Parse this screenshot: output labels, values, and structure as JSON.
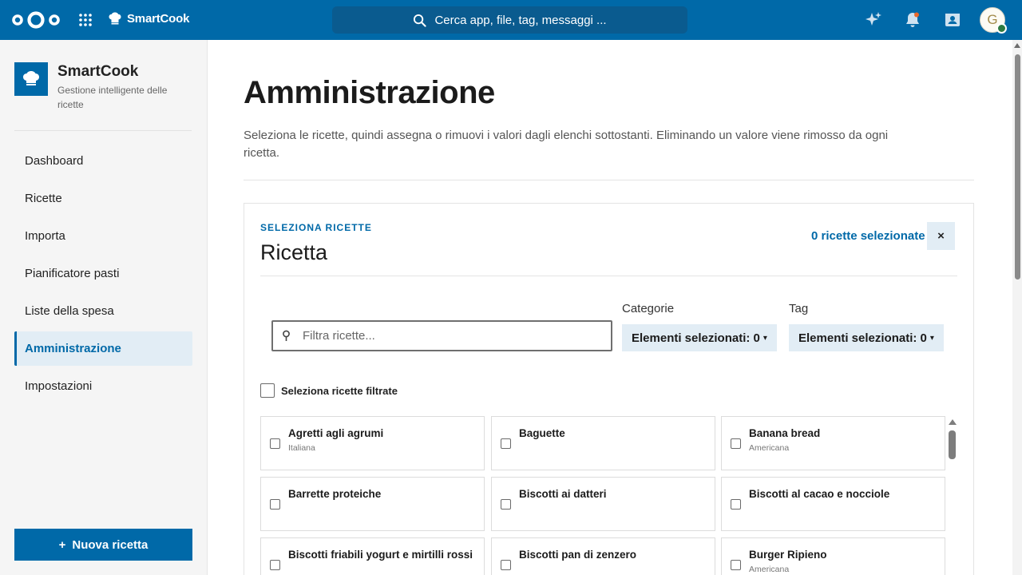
{
  "topbar": {
    "app_name": "SmartCook",
    "search_placeholder": "Cerca app, file, tag, messaggi ...",
    "avatar_initial": "G"
  },
  "sidebar": {
    "brand_title": "SmartCook",
    "brand_subtitle": "Gestione intelligente delle ricette",
    "items": [
      {
        "label": "Dashboard"
      },
      {
        "label": "Ricette"
      },
      {
        "label": "Importa"
      },
      {
        "label": "Pianificatore pasti"
      },
      {
        "label": "Liste della spesa"
      },
      {
        "label": "Amministrazione",
        "active": true
      },
      {
        "label": "Impostazioni"
      }
    ],
    "new_recipe_plus": "+",
    "new_recipe_label": "Nuova ricetta"
  },
  "main": {
    "title": "Amministrazione",
    "description": "Seleziona le ricette, quindi assegna o rimuovi i valori dagli elenchi sottostanti. Eliminando un valore viene rimosso da ogni ricetta.",
    "panel": {
      "overline": "SELEZIONA RICETTE",
      "title": "Ricetta",
      "selected_count": "0 ricette selezionate",
      "clear_label": "×",
      "filter_placeholder": "Filtra ricette...",
      "categories_label": "Categorie",
      "categories_value": "Elementi selezionati: 0",
      "tags_label": "Tag",
      "tags_value": "Elementi selezionati: 0",
      "caret": "▾",
      "select_all_label": "Seleziona ricette filtrate",
      "recipes": [
        {
          "name": "Agretti agli agrumi",
          "category": "Italiana"
        },
        {
          "name": "Baguette",
          "category": ""
        },
        {
          "name": "Banana bread",
          "category": "Americana"
        },
        {
          "name": "Barrette proteiche",
          "category": ""
        },
        {
          "name": "Biscotti ai datteri",
          "category": ""
        },
        {
          "name": "Biscotti al cacao e nocciole",
          "category": ""
        },
        {
          "name": "Biscotti friabili yogurt e mirtilli rossi",
          "category": ""
        },
        {
          "name": "Biscotti pan di zenzero",
          "category": ""
        },
        {
          "name": "Burger Ripieno",
          "category": "Americana"
        }
      ]
    }
  },
  "colors": {
    "brand": "#0069a8",
    "active_bg": "#e2edf5",
    "status_online": "#2d7b41"
  },
  "icons": {
    "logo": "nextcloud-logo-icon",
    "apps": "app-grid-icon",
    "app": "chef-hat-icon",
    "search": "search-icon",
    "assistant": "sparkle-icon",
    "notifications": "bell-icon",
    "contacts": "contacts-icon",
    "filter": "pin-icon"
  }
}
